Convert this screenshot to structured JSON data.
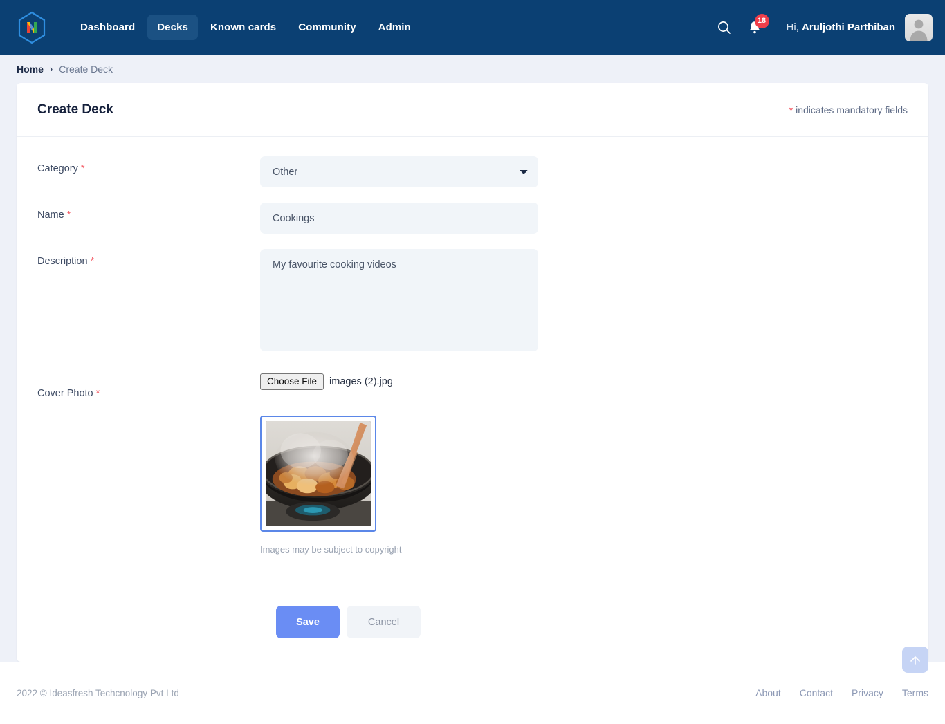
{
  "nav": {
    "logo_icon": "hexagon-n-logo-icon",
    "links": [
      {
        "label": "Dashboard",
        "active": false
      },
      {
        "label": "Decks",
        "active": true
      },
      {
        "label": "Known cards",
        "active": false
      },
      {
        "label": "Community",
        "active": false
      },
      {
        "label": "Admin",
        "active": false
      }
    ],
    "search_icon": "search-icon",
    "notification_icon": "bell-icon",
    "notification_count": "18",
    "greeting_prefix": "Hi, ",
    "user_name": "Aruljothi Parthiban",
    "avatar_icon": "user-avatar-icon"
  },
  "breadcrumb": {
    "home": "Home",
    "separator": "›",
    "current": "Create Deck"
  },
  "card": {
    "title": "Create Deck",
    "mandatory_asterisk": "*",
    "mandatory_note": " indicates mandatory fields"
  },
  "form": {
    "category": {
      "label": "Category",
      "required": "*",
      "value": "Other",
      "options": [
        "Other"
      ],
      "chevron_icon": "chevron-down-icon"
    },
    "name": {
      "label": "Name",
      "required": "*",
      "value": "Cookings",
      "placeholder": ""
    },
    "description": {
      "label": "Description",
      "required": "*",
      "value": "My favourite cooking videos",
      "placeholder": ""
    },
    "cover_photo": {
      "label": "Cover Photo",
      "required": "*",
      "choose_file_label": "Choose File",
      "file_name": "images (2).jpg",
      "preview_alt": "cooking-pan-preview",
      "copyright_note": "Images may be subject to copyright"
    }
  },
  "actions": {
    "save_label": "Save",
    "cancel_label": "Cancel"
  },
  "footer": {
    "copyright": "2022 © Ideasfresh Techcnology Pvt Ltd",
    "links": [
      "About",
      "Contact",
      "Privacy",
      "Terms"
    ],
    "scroll_top_icon": "arrow-up-icon"
  },
  "colors": {
    "nav_bg": "#0b4073",
    "nav_active": "#1b5183",
    "badge": "#ef3e4a",
    "accent_blue": "#6a8df4",
    "preview_border": "#5b87e8",
    "required_red": "#f4606a",
    "page_bg": "#eef1f8"
  }
}
